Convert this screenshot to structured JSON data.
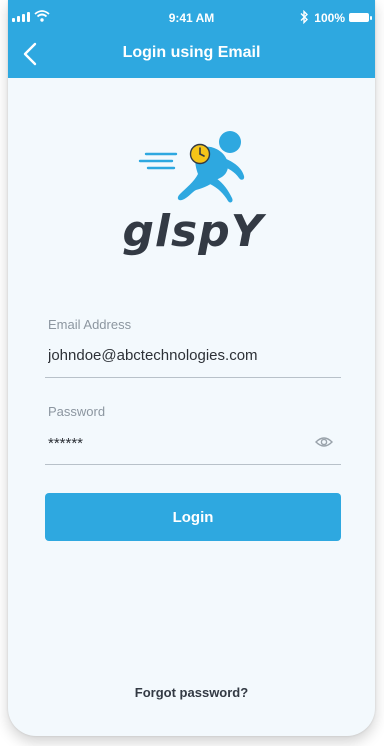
{
  "status_bar": {
    "time": "9:41 AM",
    "battery": "100%",
    "icons": [
      "signal-icon",
      "wifi-icon",
      "bluetooth-icon",
      "battery-icon"
    ]
  },
  "header": {
    "title": "Login using Email",
    "back_icon": "chevron-left-icon"
  },
  "brand": {
    "logo_icon": "running-person-clock-icon",
    "wordmark": "glspY"
  },
  "form": {
    "email": {
      "label": "Email Address",
      "value": "johndoe@abctechnologies.com"
    },
    "password": {
      "label": "Password",
      "value": "******",
      "toggle_icon": "eye-icon"
    },
    "login_label": "Login",
    "forgot_label": "Forgot password?"
  },
  "colors": {
    "accent": "#2ea8e0",
    "background": "#f3f9fd",
    "text_dark": "#333a44",
    "label_gray": "#8c96a0",
    "logo_clock": "#f5c518"
  }
}
